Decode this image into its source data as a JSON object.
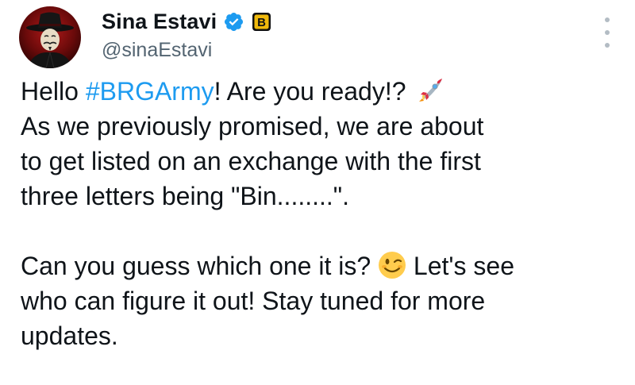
{
  "author": {
    "display_name": "Sina Estavi",
    "handle": "@sinaEstavi",
    "verified_icon": "verified-checkmark-icon",
    "affiliation_icon": "brg-badge-icon",
    "verified_color": "#1d9bf0",
    "affiliation_color": "#f0b90b"
  },
  "more_icon": "more-options-icon",
  "tweet": {
    "line1_before": "Hello ",
    "hashtag": "#BRGArmy",
    "line1_after": "! Are you ready!? ",
    "line1_emoji": "rocket-emoji",
    "line2": "As we previously promised, we are about",
    "line3": "to get listed on an exchange with the first",
    "line4": "three letters being \"Bin........\".",
    "line5_before": "Can you guess which one it is? ",
    "line5_emoji": "winking-face-emoji",
    "line5_after": " Let's see",
    "line6": "who can figure it out! Stay tuned for more",
    "line7": "updates."
  },
  "colors": {
    "text": "#0f1419",
    "secondary": "#536471",
    "link": "#1d9bf0"
  }
}
